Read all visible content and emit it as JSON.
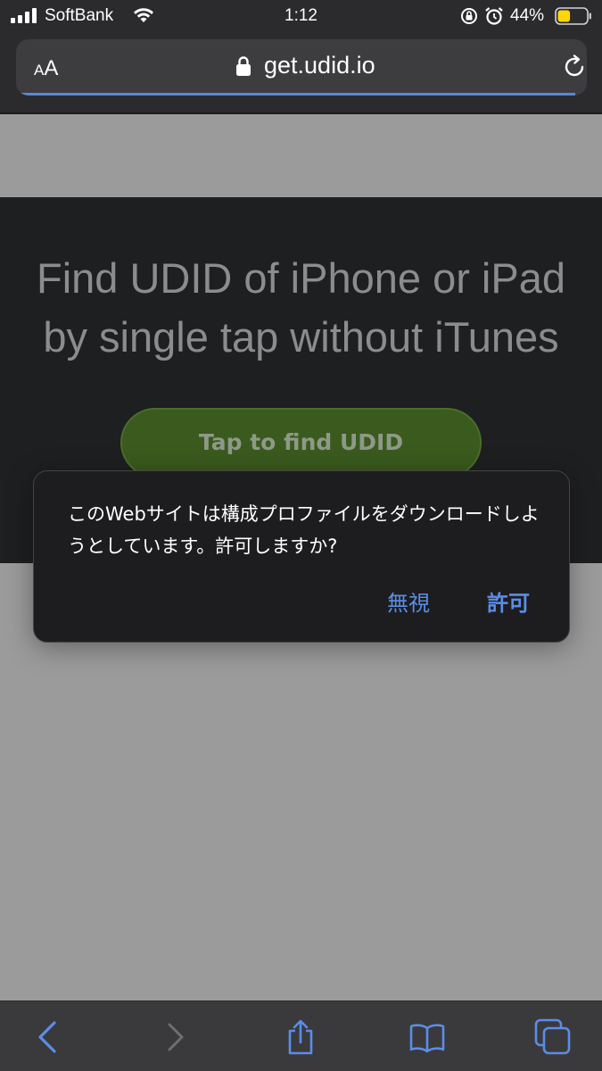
{
  "status_bar": {
    "carrier": "SoftBank",
    "time": "1:12",
    "battery_percent": "44%",
    "battery_level": 0.44
  },
  "address_bar": {
    "reader_small": "A",
    "reader_big": "A",
    "domain": "get.udid.io",
    "load_progress": 0.98
  },
  "page": {
    "headline": "Find UDID of iPhone or iPad\nby single tap without iTunes",
    "cta_label": "Tap to find UDID"
  },
  "dialog": {
    "message": "このWebサイトは構成プロファイルをダウンロードしようとしています。許可しますか?",
    "ignore_label": "無視",
    "allow_label": "許可"
  },
  "toolbar": {
    "icons": [
      "back-icon",
      "forward-icon",
      "share-icon",
      "bookmarks-icon",
      "tabs-icon"
    ]
  },
  "colors": {
    "accent": "#5b8de8",
    "cta_green": "#3a5a1e",
    "hero_bg": "#1d1f21"
  }
}
